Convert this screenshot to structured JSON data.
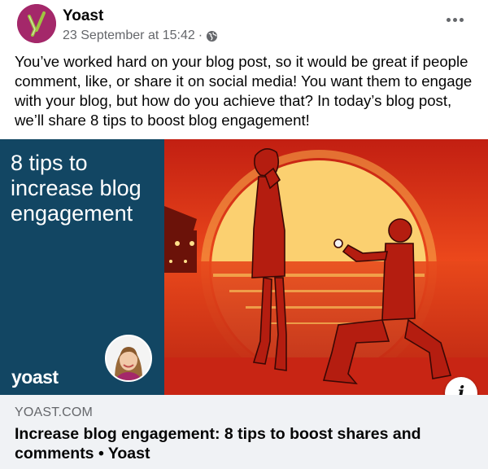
{
  "header": {
    "page_name": "Yoast",
    "timestamp": "23 September at 15:42",
    "separator": "·",
    "audience_icon": "globe-icon",
    "more_icon": "more-options-icon"
  },
  "post": {
    "text": "You’ve worked hard on your blog post, so it would be great if people comment, like, or share it on social media! You want them to engage with your blog, but how do you achieve that? In today’s blog post, we’ll share 8 tips to boost blog engagement!"
  },
  "preview": {
    "image_title": "8 tips to increase blog engagement",
    "brand": "yoast",
    "info_icon": "i",
    "domain": "YOAST.COM",
    "link_title": "Increase blog engagement: 8 tips to boost shares and comments • Yoast"
  },
  "colors": {
    "brand_purple": "#a4286a",
    "panel_blue": "#124663",
    "sunset_red": "#e2361c",
    "meta_gray": "#65676b",
    "link_bg": "#f0f2f5"
  }
}
